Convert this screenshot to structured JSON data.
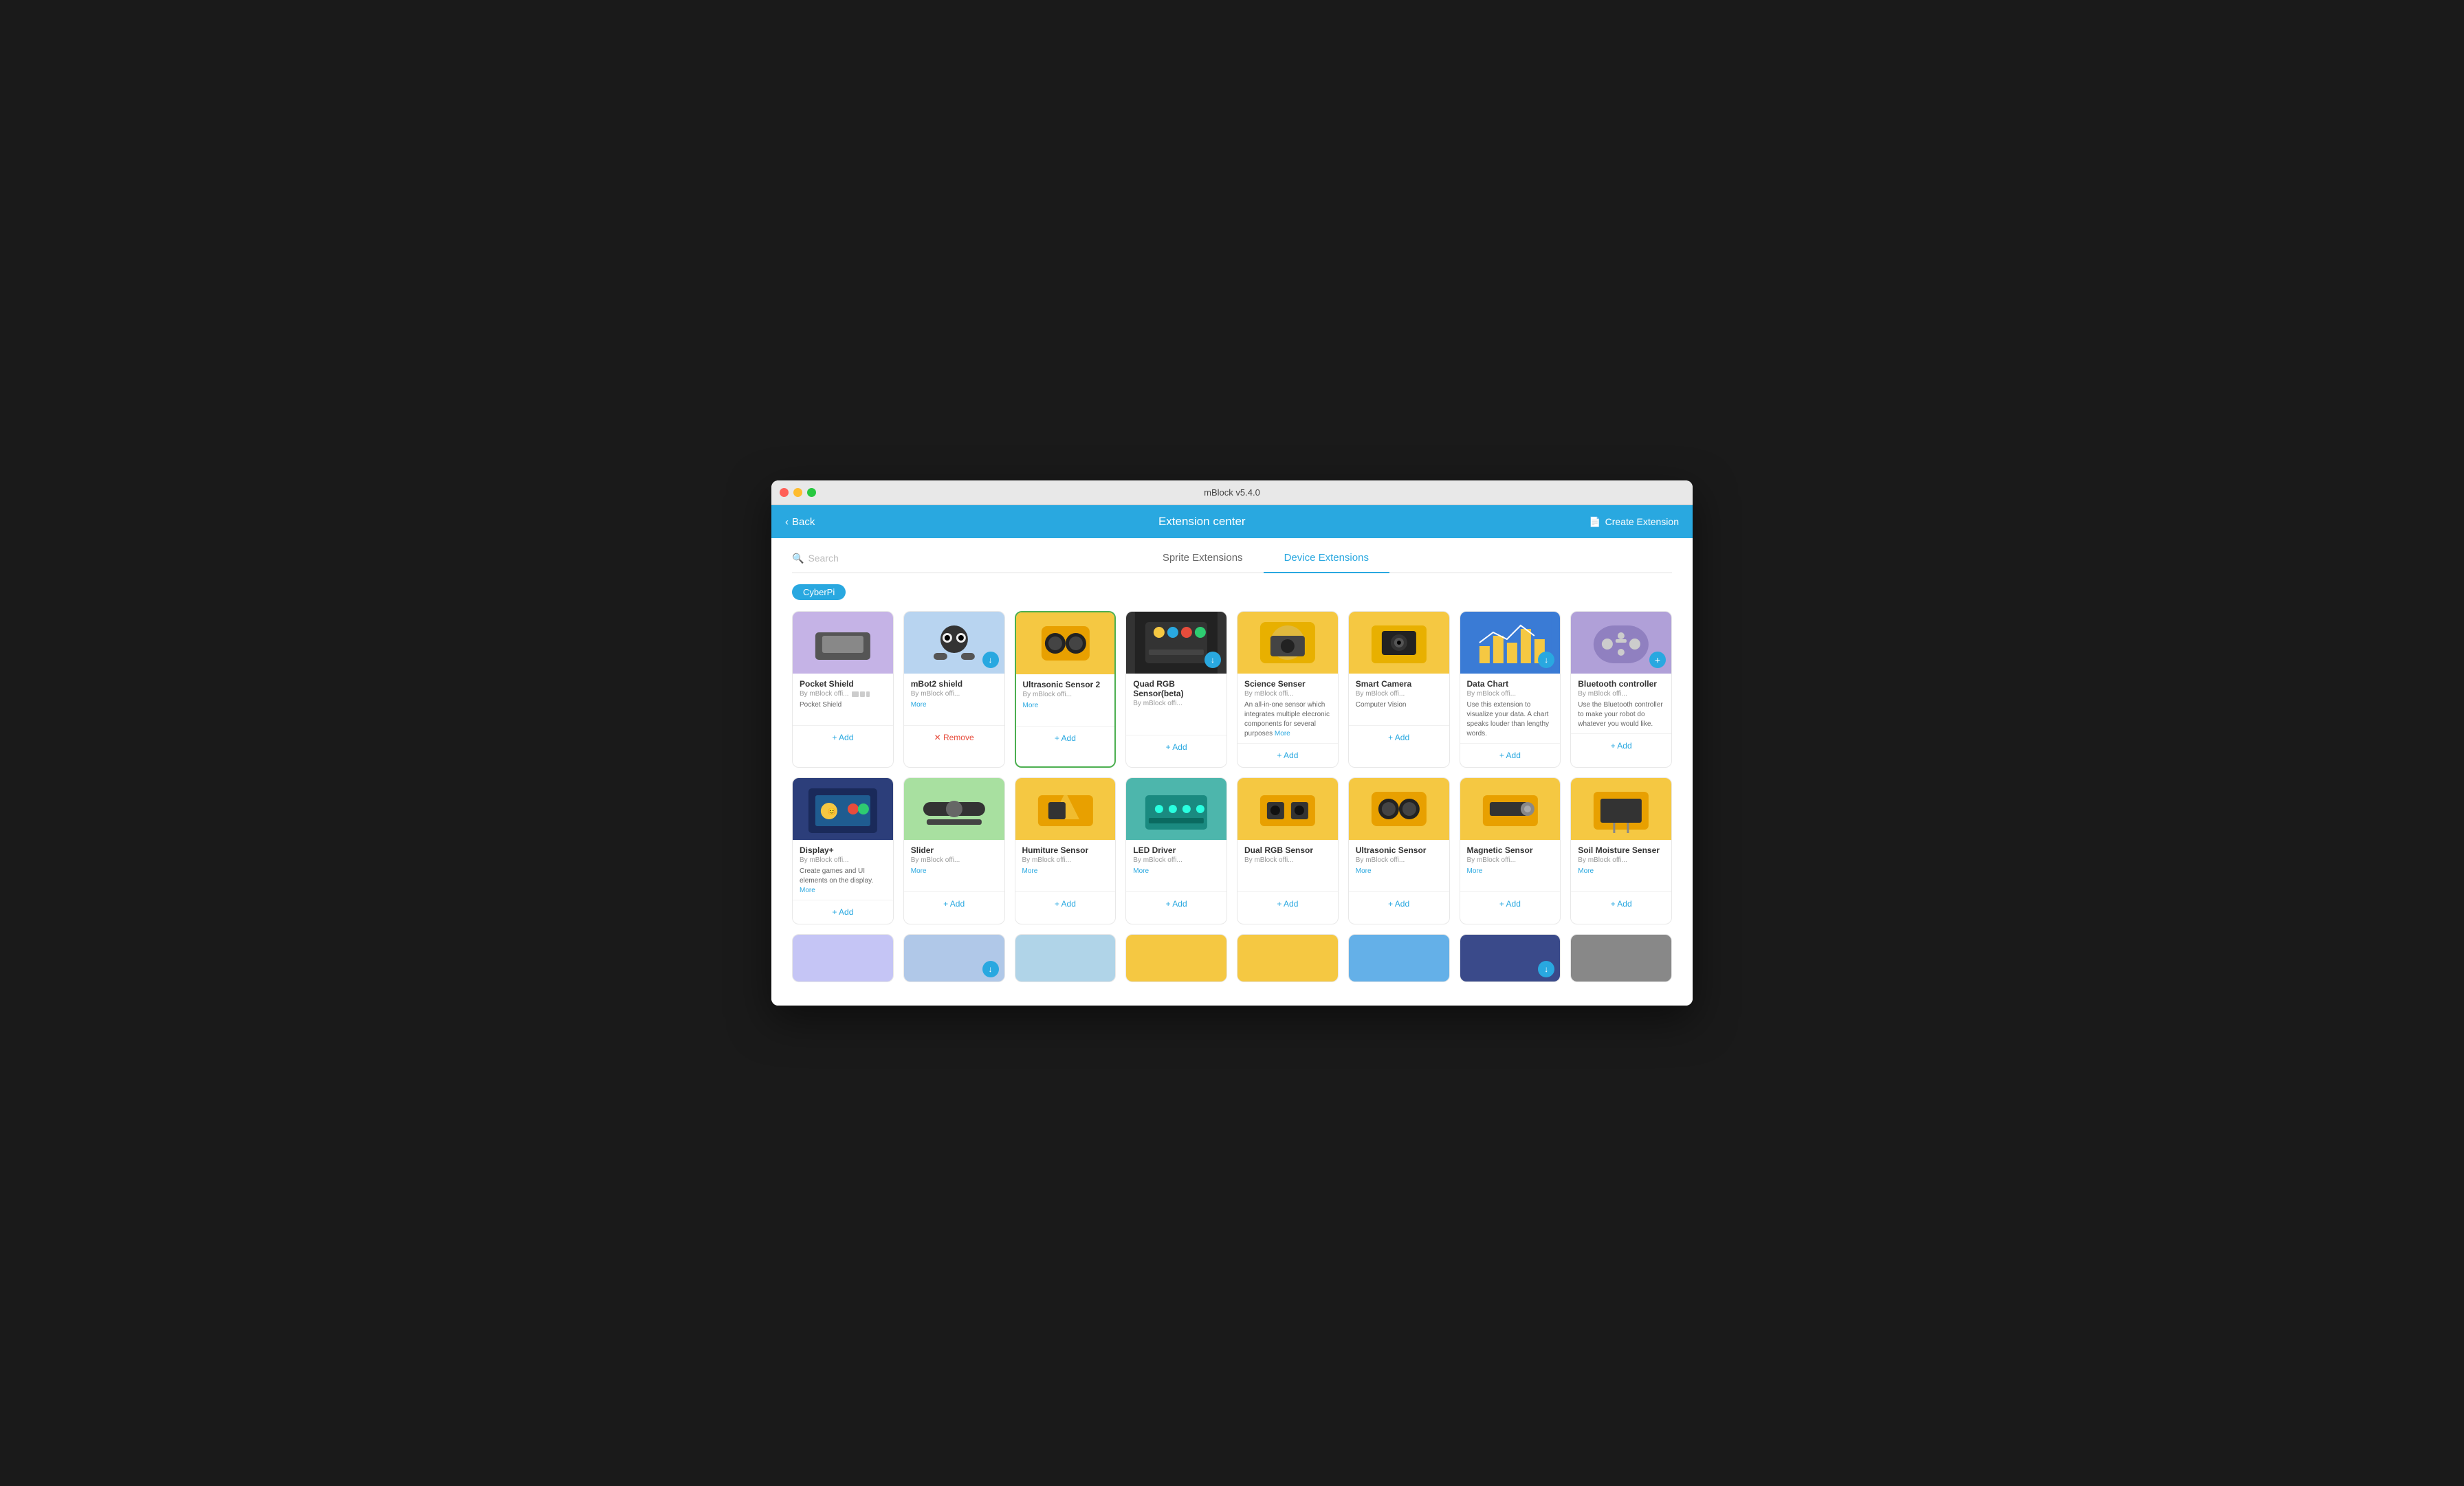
{
  "window": {
    "title": "mBlock v5.4.0",
    "traffic_lights": [
      "red",
      "yellow",
      "green"
    ]
  },
  "header": {
    "back_label": "Back",
    "title": "Extension center",
    "create_label": "Create Extension"
  },
  "search": {
    "placeholder": "Search"
  },
  "tabs": [
    {
      "id": "sprite",
      "label": "Sprite Extensions",
      "active": false
    },
    {
      "id": "device",
      "label": "Device Extensions",
      "active": true
    }
  ],
  "filter": {
    "tags": [
      {
        "label": "CyberPi",
        "active": true
      }
    ]
  },
  "row1": [
    {
      "name": "Pocket Shield",
      "author": "By mBlock offi...",
      "desc": "Pocket Shield",
      "more": false,
      "action": "add",
      "action_label": "+ Add",
      "bg": "purple",
      "has_download": false
    },
    {
      "name": "mBot2 shield",
      "author": "By mBlock offi...",
      "desc": "",
      "more": true,
      "more_label": "More",
      "action": "remove",
      "action_label": "✕ Remove",
      "bg": "blue-light",
      "has_download": true
    },
    {
      "name": "Ultrasonic Sensor 2",
      "author": "By mBlock offi...",
      "desc": "",
      "more": true,
      "more_label": "More",
      "action": "add",
      "action_label": "+ Add",
      "bg": "yellow",
      "has_download": false,
      "selected": true
    },
    {
      "name": "Quad RGB Sensor(beta)",
      "author": "By mBlock offi...",
      "desc": "",
      "more": false,
      "action": "add",
      "action_label": "+ Add",
      "bg": "dark",
      "has_download": true
    },
    {
      "name": "Science Senser",
      "author": "By mBlock offi...",
      "desc": "An all-in-one sensor which integrates multiple elecronic components for several purposes",
      "more": true,
      "more_label": "More",
      "action": "add",
      "action_label": "+ Add",
      "bg": "yellow",
      "has_download": false
    },
    {
      "name": "Smart Camera",
      "author": "By mBlock offi...",
      "desc": "Computer Vision",
      "more": false,
      "action": "add",
      "action_label": "+ Add",
      "bg": "yellow",
      "has_download": false
    },
    {
      "name": "Data Chart",
      "author": "By mBlock offi...",
      "desc": "Use this extension to visualize your data. A chart speaks louder than lengthy words.",
      "more": false,
      "action": "add",
      "action_label": "+ Add",
      "bg": "blue-dark",
      "has_download": true
    },
    {
      "name": "Bluetooth controller",
      "author": "By mBlock offi...",
      "desc": "Use the Bluetooth controller to make your robot do whatever you would like.",
      "more": false,
      "action": "add",
      "action_label": "+ Add",
      "bg": "light-purple",
      "has_download": false,
      "has_plus": true
    }
  ],
  "row2": [
    {
      "name": "Display+",
      "author": "By mBlock offi...",
      "desc": "Create games and UI elements on the display.",
      "more": true,
      "more_label": "More",
      "action": "add",
      "action_label": "+ Add",
      "bg": "dark-blue"
    },
    {
      "name": "Slider",
      "author": "By mBlock offi...",
      "desc": "",
      "more": true,
      "more_label": "More",
      "action": "add",
      "action_label": "+ Add",
      "bg": "green"
    },
    {
      "name": "Humiture Sensor",
      "author": "By mBlock offi...",
      "desc": "",
      "more": true,
      "more_label": "More",
      "action": "add",
      "action_label": "+ Add",
      "bg": "yellow"
    },
    {
      "name": "LED Driver",
      "author": "By mBlock offi...",
      "desc": "",
      "more": true,
      "more_label": "More",
      "action": "add",
      "action_label": "+ Add",
      "bg": "teal"
    },
    {
      "name": "Dual RGB Sensor",
      "author": "By mBlock offi...",
      "desc": "",
      "more": false,
      "action": "add",
      "action_label": "+ Add",
      "bg": "yellow"
    },
    {
      "name": "Ultrasonic Sensor",
      "author": "By mBlock offi...",
      "desc": "",
      "more": true,
      "more_label": "More",
      "action": "add",
      "action_label": "+ Add",
      "bg": "yellow"
    },
    {
      "name": "Magnetic Sensor",
      "author": "By mBlock offi...",
      "desc": "",
      "more": true,
      "more_label": "More",
      "action": "add",
      "action_label": "+ Add",
      "bg": "yellow"
    },
    {
      "name": "Soil Moisture Senser",
      "author": "By mBlock offi...",
      "desc": "",
      "more": true,
      "more_label": "More",
      "action": "add",
      "action_label": "+ Add",
      "bg": "yellow"
    }
  ],
  "device_icons": [
    "monitor",
    "tablet",
    "phone"
  ],
  "colors": {
    "primary": "#29a8e0",
    "add": "#29a8e0",
    "remove": "#e74c3c",
    "selected_border": "#4caf50"
  }
}
